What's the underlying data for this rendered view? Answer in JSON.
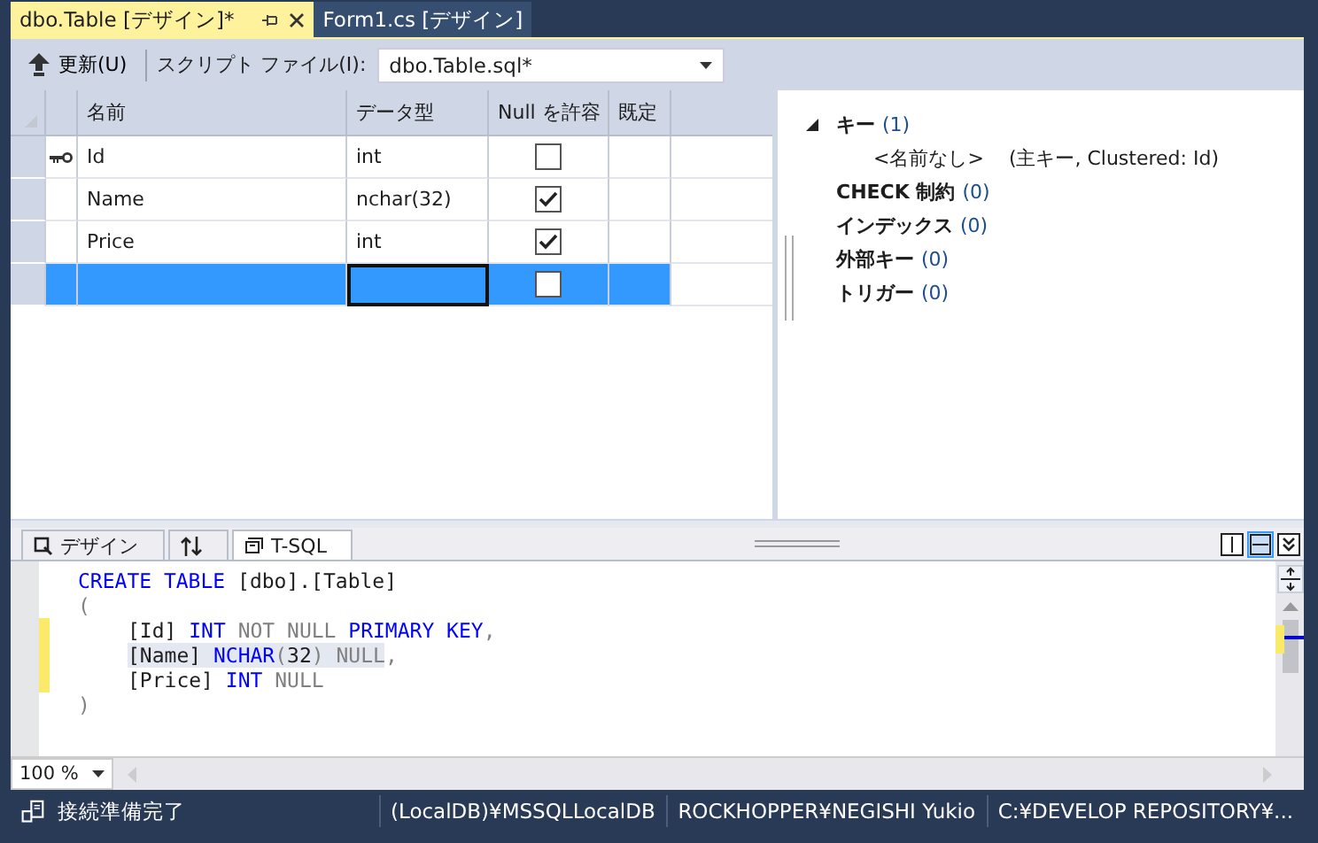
{
  "document_tabs": [
    {
      "label": "dbo.Table [デザイン]*",
      "selected": true
    },
    {
      "label": "Form1.cs [デザイン]",
      "selected": false
    }
  ],
  "toolbar": {
    "update_button": "更新(U)",
    "script_label": "スクリプト ファイル(I):",
    "script_file": "dbo.Table.sql*"
  },
  "grid": {
    "columns": [
      "名前",
      "データ型",
      "Null を許容",
      "既定"
    ],
    "rows": [
      {
        "key": true,
        "name": "Id",
        "type": "int",
        "allow_null": false,
        "selected": false
      },
      {
        "key": false,
        "name": "Name",
        "type": "nchar(32)",
        "allow_null": true,
        "selected": false
      },
      {
        "key": false,
        "name": "Price",
        "type": "int",
        "allow_null": true,
        "selected": false
      },
      {
        "key": false,
        "allow_null": false,
        "selected": true
      }
    ]
  },
  "tree": [
    {
      "label": "キー",
      "count": "(1)",
      "expanded": true,
      "children": [
        {
          "label": "<名前なし>",
          "count": "(主キー, Clustered: Id)"
        }
      ]
    },
    {
      "label": "CHECK 制約",
      "count": "(0)"
    },
    {
      "label": "インデックス",
      "count": "(0)"
    },
    {
      "label": "外部キー",
      "count": "(0)"
    },
    {
      "label": "トリガー",
      "count": "(0)"
    }
  ],
  "pane_tabs": [
    {
      "kind": "design",
      "label": "デザイン",
      "selected": false
    },
    {
      "kind": "swap",
      "selected": false
    },
    {
      "kind": "tsql",
      "label": "T-SQL",
      "selected": true
    }
  ],
  "sql_lines": [
    {
      "changed": false,
      "indented": false,
      "tokens": [
        {
          "text": "CREATE TABLE",
          "kind": "keyword"
        },
        {
          "text": " [dbo].[Table]",
          "kind": "plain"
        }
      ]
    },
    {
      "changed": false,
      "indented": false,
      "tokens": [
        {
          "text": "(",
          "kind": "gray"
        }
      ]
    },
    {
      "changed": true,
      "indented": true,
      "tokens": [
        {
          "text": "[Id] ",
          "kind": "plain"
        },
        {
          "text": "INT",
          "kind": "keyword"
        },
        {
          "text": " NOT NULL ",
          "kind": "gray"
        },
        {
          "text": "PRIMARY KEY",
          "kind": "keyword"
        },
        {
          "text": ",",
          "kind": "gray"
        }
      ]
    },
    {
      "changed": true,
      "indented": true,
      "tokens": [
        {
          "text": "[Name] ",
          "kind": "plain",
          "highlighted": true
        },
        {
          "text": "NCHAR",
          "kind": "keyword",
          "highlighted": true
        },
        {
          "text": "(",
          "kind": "gray",
          "highlighted": true
        },
        {
          "text": "32",
          "kind": "plain",
          "highlighted": true
        },
        {
          "text": ") NULL",
          "kind": "gray",
          "highlighted": true
        },
        {
          "text": ",",
          "kind": "gray"
        }
      ]
    },
    {
      "changed": true,
      "indented": true,
      "tokens": [
        {
          "text": "[Price] ",
          "kind": "plain"
        },
        {
          "text": "INT",
          "kind": "keyword"
        },
        {
          "text": " NULL",
          "kind": "gray"
        }
      ]
    },
    {
      "changed": false,
      "indented": false,
      "tokens": [
        {
          "text": ")",
          "kind": "gray"
        }
      ]
    }
  ],
  "zoom": "100 %",
  "status_bar": [
    "接続準備完了",
    "(LocalDB)¥MSSQLLocalDB",
    "ROCKHOPPER¥NEGISHI Yukio",
    "C:¥DEVELOP REPOSITORY¥..."
  ]
}
